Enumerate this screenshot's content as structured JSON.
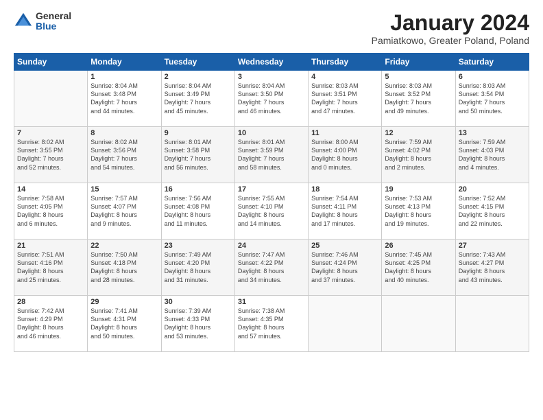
{
  "logo": {
    "general": "General",
    "blue": "Blue"
  },
  "title": "January 2024",
  "subtitle": "Pamiatkowo, Greater Poland, Poland",
  "days": [
    "Sunday",
    "Monday",
    "Tuesday",
    "Wednesday",
    "Thursday",
    "Friday",
    "Saturday"
  ],
  "weeks": [
    [
      {
        "num": "",
        "lines": []
      },
      {
        "num": "1",
        "lines": [
          "Sunrise: 8:04 AM",
          "Sunset: 3:48 PM",
          "Daylight: 7 hours",
          "and 44 minutes."
        ]
      },
      {
        "num": "2",
        "lines": [
          "Sunrise: 8:04 AM",
          "Sunset: 3:49 PM",
          "Daylight: 7 hours",
          "and 45 minutes."
        ]
      },
      {
        "num": "3",
        "lines": [
          "Sunrise: 8:04 AM",
          "Sunset: 3:50 PM",
          "Daylight: 7 hours",
          "and 46 minutes."
        ]
      },
      {
        "num": "4",
        "lines": [
          "Sunrise: 8:03 AM",
          "Sunset: 3:51 PM",
          "Daylight: 7 hours",
          "and 47 minutes."
        ]
      },
      {
        "num": "5",
        "lines": [
          "Sunrise: 8:03 AM",
          "Sunset: 3:52 PM",
          "Daylight: 7 hours",
          "and 49 minutes."
        ]
      },
      {
        "num": "6",
        "lines": [
          "Sunrise: 8:03 AM",
          "Sunset: 3:54 PM",
          "Daylight: 7 hours",
          "and 50 minutes."
        ]
      }
    ],
    [
      {
        "num": "7",
        "lines": [
          "Sunrise: 8:02 AM",
          "Sunset: 3:55 PM",
          "Daylight: 7 hours",
          "and 52 minutes."
        ]
      },
      {
        "num": "8",
        "lines": [
          "Sunrise: 8:02 AM",
          "Sunset: 3:56 PM",
          "Daylight: 7 hours",
          "and 54 minutes."
        ]
      },
      {
        "num": "9",
        "lines": [
          "Sunrise: 8:01 AM",
          "Sunset: 3:58 PM",
          "Daylight: 7 hours",
          "and 56 minutes."
        ]
      },
      {
        "num": "10",
        "lines": [
          "Sunrise: 8:01 AM",
          "Sunset: 3:59 PM",
          "Daylight: 7 hours",
          "and 58 minutes."
        ]
      },
      {
        "num": "11",
        "lines": [
          "Sunrise: 8:00 AM",
          "Sunset: 4:00 PM",
          "Daylight: 8 hours",
          "and 0 minutes."
        ]
      },
      {
        "num": "12",
        "lines": [
          "Sunrise: 7:59 AM",
          "Sunset: 4:02 PM",
          "Daylight: 8 hours",
          "and 2 minutes."
        ]
      },
      {
        "num": "13",
        "lines": [
          "Sunrise: 7:59 AM",
          "Sunset: 4:03 PM",
          "Daylight: 8 hours",
          "and 4 minutes."
        ]
      }
    ],
    [
      {
        "num": "14",
        "lines": [
          "Sunrise: 7:58 AM",
          "Sunset: 4:05 PM",
          "Daylight: 8 hours",
          "and 6 minutes."
        ]
      },
      {
        "num": "15",
        "lines": [
          "Sunrise: 7:57 AM",
          "Sunset: 4:07 PM",
          "Daylight: 8 hours",
          "and 9 minutes."
        ]
      },
      {
        "num": "16",
        "lines": [
          "Sunrise: 7:56 AM",
          "Sunset: 4:08 PM",
          "Daylight: 8 hours",
          "and 11 minutes."
        ]
      },
      {
        "num": "17",
        "lines": [
          "Sunrise: 7:55 AM",
          "Sunset: 4:10 PM",
          "Daylight: 8 hours",
          "and 14 minutes."
        ]
      },
      {
        "num": "18",
        "lines": [
          "Sunrise: 7:54 AM",
          "Sunset: 4:11 PM",
          "Daylight: 8 hours",
          "and 17 minutes."
        ]
      },
      {
        "num": "19",
        "lines": [
          "Sunrise: 7:53 AM",
          "Sunset: 4:13 PM",
          "Daylight: 8 hours",
          "and 19 minutes."
        ]
      },
      {
        "num": "20",
        "lines": [
          "Sunrise: 7:52 AM",
          "Sunset: 4:15 PM",
          "Daylight: 8 hours",
          "and 22 minutes."
        ]
      }
    ],
    [
      {
        "num": "21",
        "lines": [
          "Sunrise: 7:51 AM",
          "Sunset: 4:16 PM",
          "Daylight: 8 hours",
          "and 25 minutes."
        ]
      },
      {
        "num": "22",
        "lines": [
          "Sunrise: 7:50 AM",
          "Sunset: 4:18 PM",
          "Daylight: 8 hours",
          "and 28 minutes."
        ]
      },
      {
        "num": "23",
        "lines": [
          "Sunrise: 7:49 AM",
          "Sunset: 4:20 PM",
          "Daylight: 8 hours",
          "and 31 minutes."
        ]
      },
      {
        "num": "24",
        "lines": [
          "Sunrise: 7:47 AM",
          "Sunset: 4:22 PM",
          "Daylight: 8 hours",
          "and 34 minutes."
        ]
      },
      {
        "num": "25",
        "lines": [
          "Sunrise: 7:46 AM",
          "Sunset: 4:24 PM",
          "Daylight: 8 hours",
          "and 37 minutes."
        ]
      },
      {
        "num": "26",
        "lines": [
          "Sunrise: 7:45 AM",
          "Sunset: 4:25 PM",
          "Daylight: 8 hours",
          "and 40 minutes."
        ]
      },
      {
        "num": "27",
        "lines": [
          "Sunrise: 7:43 AM",
          "Sunset: 4:27 PM",
          "Daylight: 8 hours",
          "and 43 minutes."
        ]
      }
    ],
    [
      {
        "num": "28",
        "lines": [
          "Sunrise: 7:42 AM",
          "Sunset: 4:29 PM",
          "Daylight: 8 hours",
          "and 46 minutes."
        ]
      },
      {
        "num": "29",
        "lines": [
          "Sunrise: 7:41 AM",
          "Sunset: 4:31 PM",
          "Daylight: 8 hours",
          "and 50 minutes."
        ]
      },
      {
        "num": "30",
        "lines": [
          "Sunrise: 7:39 AM",
          "Sunset: 4:33 PM",
          "Daylight: 8 hours",
          "and 53 minutes."
        ]
      },
      {
        "num": "31",
        "lines": [
          "Sunrise: 7:38 AM",
          "Sunset: 4:35 PM",
          "Daylight: 8 hours",
          "and 57 minutes."
        ]
      },
      {
        "num": "",
        "lines": []
      },
      {
        "num": "",
        "lines": []
      },
      {
        "num": "",
        "lines": []
      }
    ]
  ]
}
